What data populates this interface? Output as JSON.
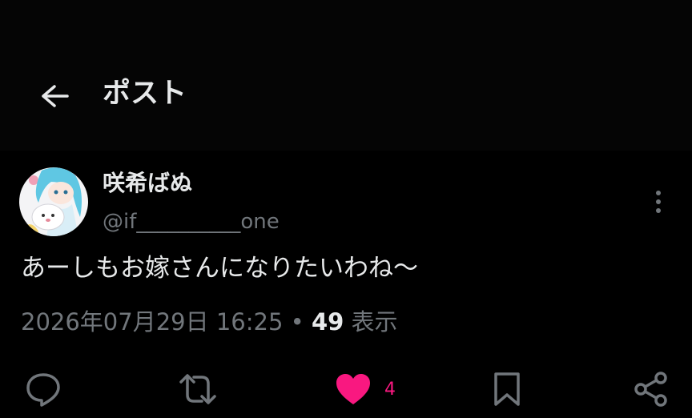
{
  "header": {
    "back_icon": "arrow-left-icon",
    "title": "ポスト"
  },
  "post": {
    "author": {
      "display_name": "咲希ばぬ",
      "handle": "@if__________one",
      "avatar_icon": "avatar-anime-character"
    },
    "text": "あーしもお嫁さんになりたいわね〜",
    "date": "2026年07月29日",
    "time": "16:25",
    "separator": "•",
    "views_count": "49",
    "views_label": "表示"
  },
  "actions": {
    "reply_icon": "chat-bubble-icon",
    "repost_icon": "repost-icon",
    "like_icon": "heart-filled-icon",
    "like_count": "4",
    "bookmark_icon": "bookmark-icon",
    "share_icon": "share-icon"
  },
  "colors": {
    "background": "#000000",
    "header_background": "#050505",
    "text_primary": "#e7e9ea",
    "text_secondary": "#71767b",
    "like_accent": "#f91880"
  }
}
